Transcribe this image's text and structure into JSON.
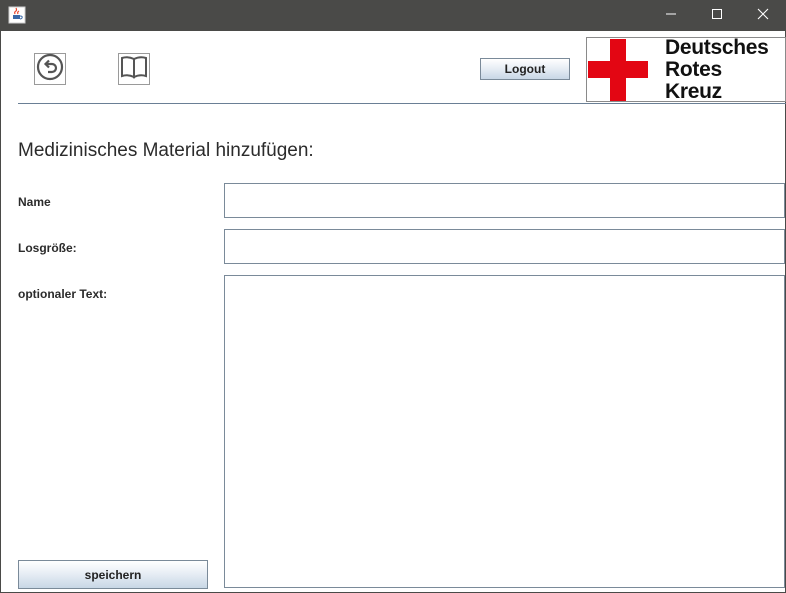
{
  "window": {
    "icon": "java-coffee-cup-icon",
    "controls": [
      "minimize-icon",
      "maximize-icon",
      "close-icon"
    ]
  },
  "toolbar": {
    "back_icon": "undo-arrow-icon",
    "book_icon": "open-book-icon",
    "logout_label": "Logout"
  },
  "logo": {
    "lines": [
      "Deutsches",
      "Rotes",
      "Kreuz"
    ],
    "cross_color": "#e30613"
  },
  "form": {
    "heading": "Medizinisches Material hinzufügen:",
    "name_label": "Name",
    "name_value": "",
    "lot_label": "Losgröße:",
    "lot_value": "",
    "text_label": "optionaler Text:",
    "text_value": "",
    "save_label": "speichern"
  }
}
